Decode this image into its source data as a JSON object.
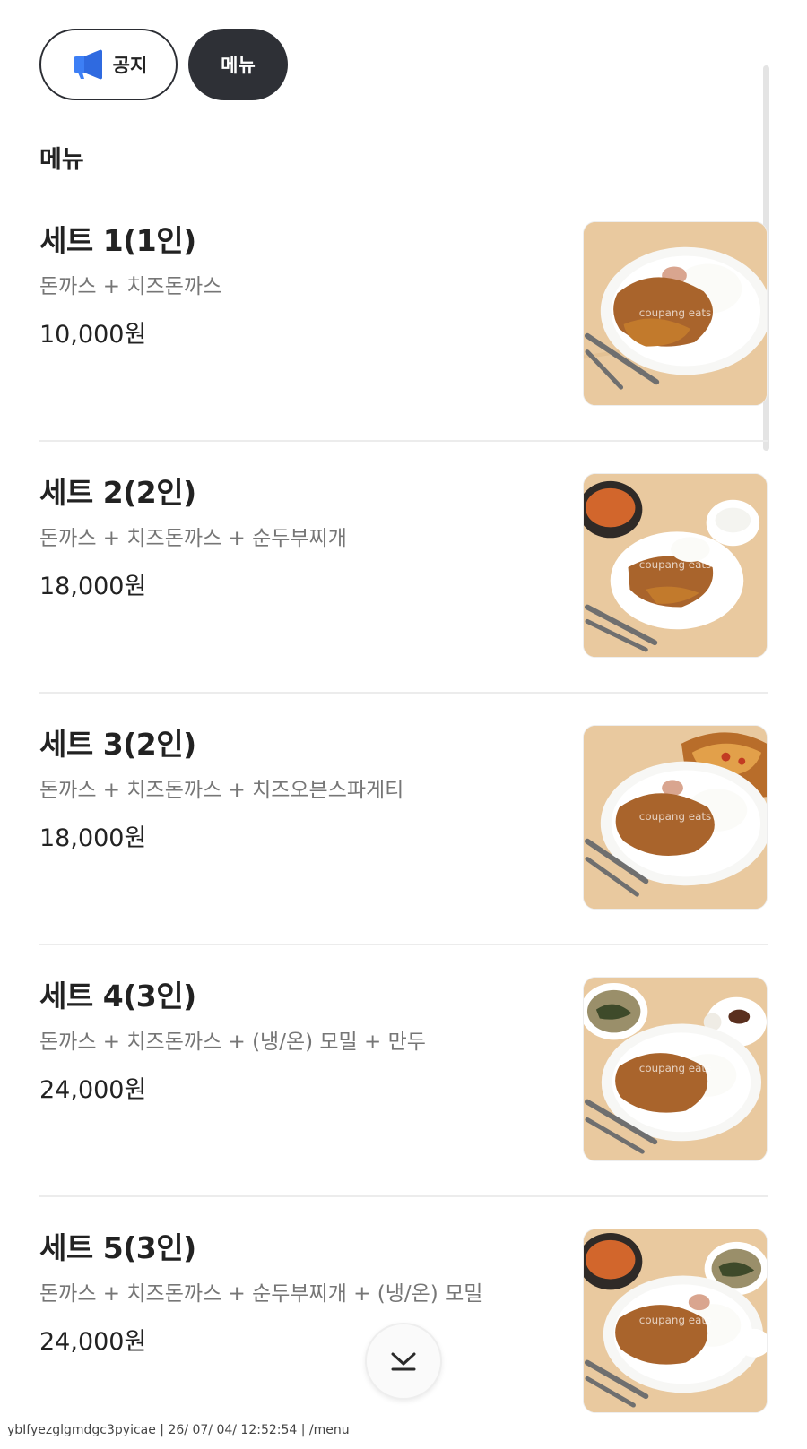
{
  "tabs": {
    "notice_label": "공지",
    "menu_label": "메뉴"
  },
  "section_title": "메뉴",
  "menu_items": [
    {
      "name": "세트 1(1인)",
      "description": "돈까스 + 치즈돈까스",
      "price": "10,000원",
      "watermark": "coupang eats"
    },
    {
      "name": "세트 2(2인)",
      "description": "돈까스 + 치즈돈까스 + 순두부찌개",
      "price": "18,000원",
      "watermark": "coupang eats"
    },
    {
      "name": "세트 3(2인)",
      "description": "돈까스 + 치즈돈까스 + 치즈오븐스파게티",
      "price": "18,000원",
      "watermark": "coupang eats"
    },
    {
      "name": "세트 4(3인)",
      "description": "돈까스 + 치즈돈까스 + (냉/온) 모밀 + 만두",
      "price": "24,000원",
      "watermark": "coupang eats"
    },
    {
      "name": "세트 5(3인)",
      "description": "돈까스 + 치즈돈까스 + 순두부찌개 + (냉/온) 모밀",
      "price": "24,000원",
      "watermark": "coupang eats"
    }
  ],
  "footer": "ybIfyezglgmdgc3pyicae | 26/ 07/ 04/ 12:52:54 | /menu",
  "icons": {
    "notice_icon": "megaphone-icon",
    "scroll_icon": "chevron-down-icon"
  },
  "colors": {
    "active_tab_bg": "#2e3036",
    "notice_icon": "#3d7ff5",
    "description_text": "#767676"
  }
}
